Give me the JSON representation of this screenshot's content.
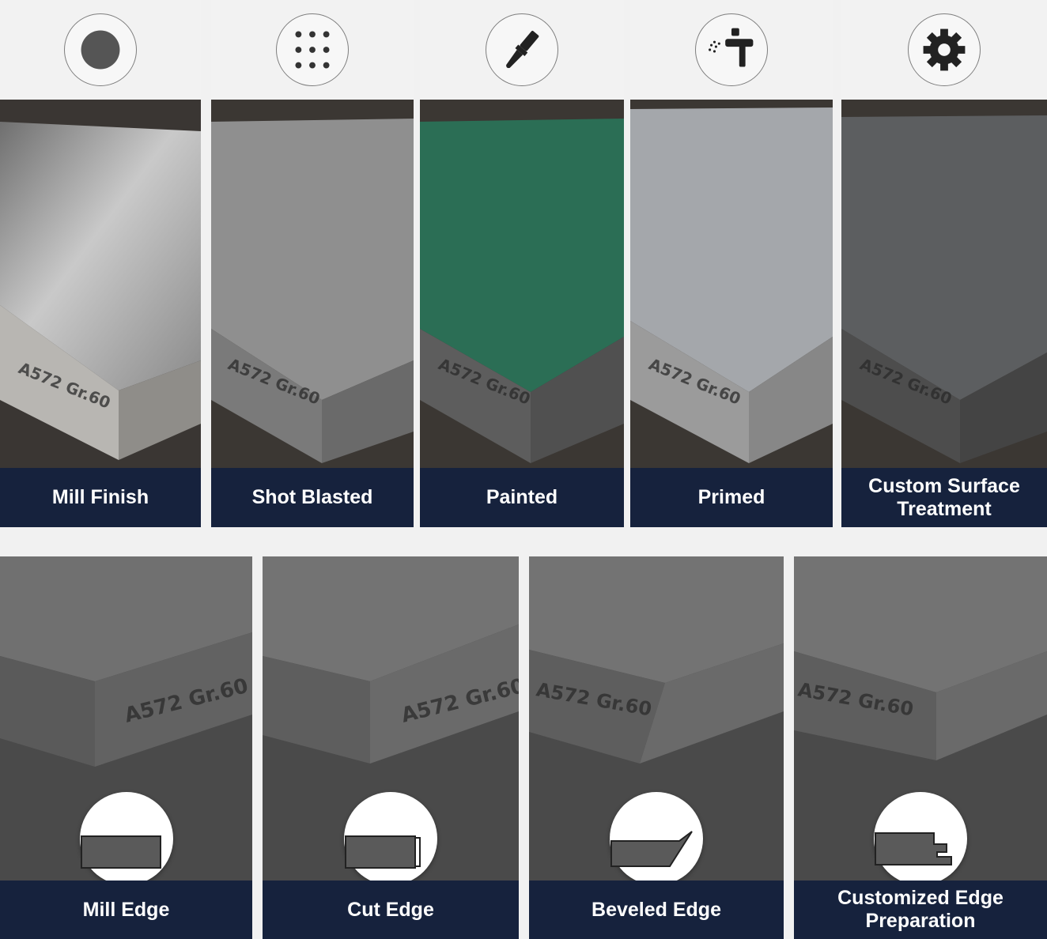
{
  "surface_finishes": [
    {
      "label": "Mill Finish",
      "icon": "solid-circle-icon",
      "plate_marking": "A572 Gr.60",
      "surface_color": "#9a9a9a"
    },
    {
      "label": "Shot Blasted",
      "icon": "dot-grid-icon",
      "plate_marking": "A572 Gr.60",
      "surface_color": "#8e8e8e"
    },
    {
      "label": "Painted",
      "icon": "paintbrush-icon",
      "plate_marking": "A572 Gr.60",
      "surface_color": "#2b6e55"
    },
    {
      "label": "Primed",
      "icon": "spray-gun-icon",
      "plate_marking": "A572 Gr.60",
      "surface_color": "#a4a7ab"
    },
    {
      "label": "Custom Surface Treatment",
      "icon": "gear-icon",
      "plate_marking": "A572 Gr.60",
      "surface_color": "#5c5e60"
    }
  ],
  "edge_preparations": [
    {
      "label": "Mill Edge",
      "icon": "mill-edge-profile-icon",
      "plate_marking": "A572 Gr.60"
    },
    {
      "label": "Cut Edge",
      "icon": "cut-edge-profile-icon",
      "plate_marking": "A572 Gr.60"
    },
    {
      "label": "Beveled Edge",
      "icon": "beveled-edge-profile-icon",
      "plate_marking": "A572 Gr.60"
    },
    {
      "label": "Customized Edge Preparation",
      "icon": "custom-edge-profile-icon",
      "plate_marking": "A572 Gr.60"
    }
  ],
  "colors": {
    "label_bar": "#16223d",
    "label_text": "#ffffff",
    "background": "#f1f1f1"
  }
}
